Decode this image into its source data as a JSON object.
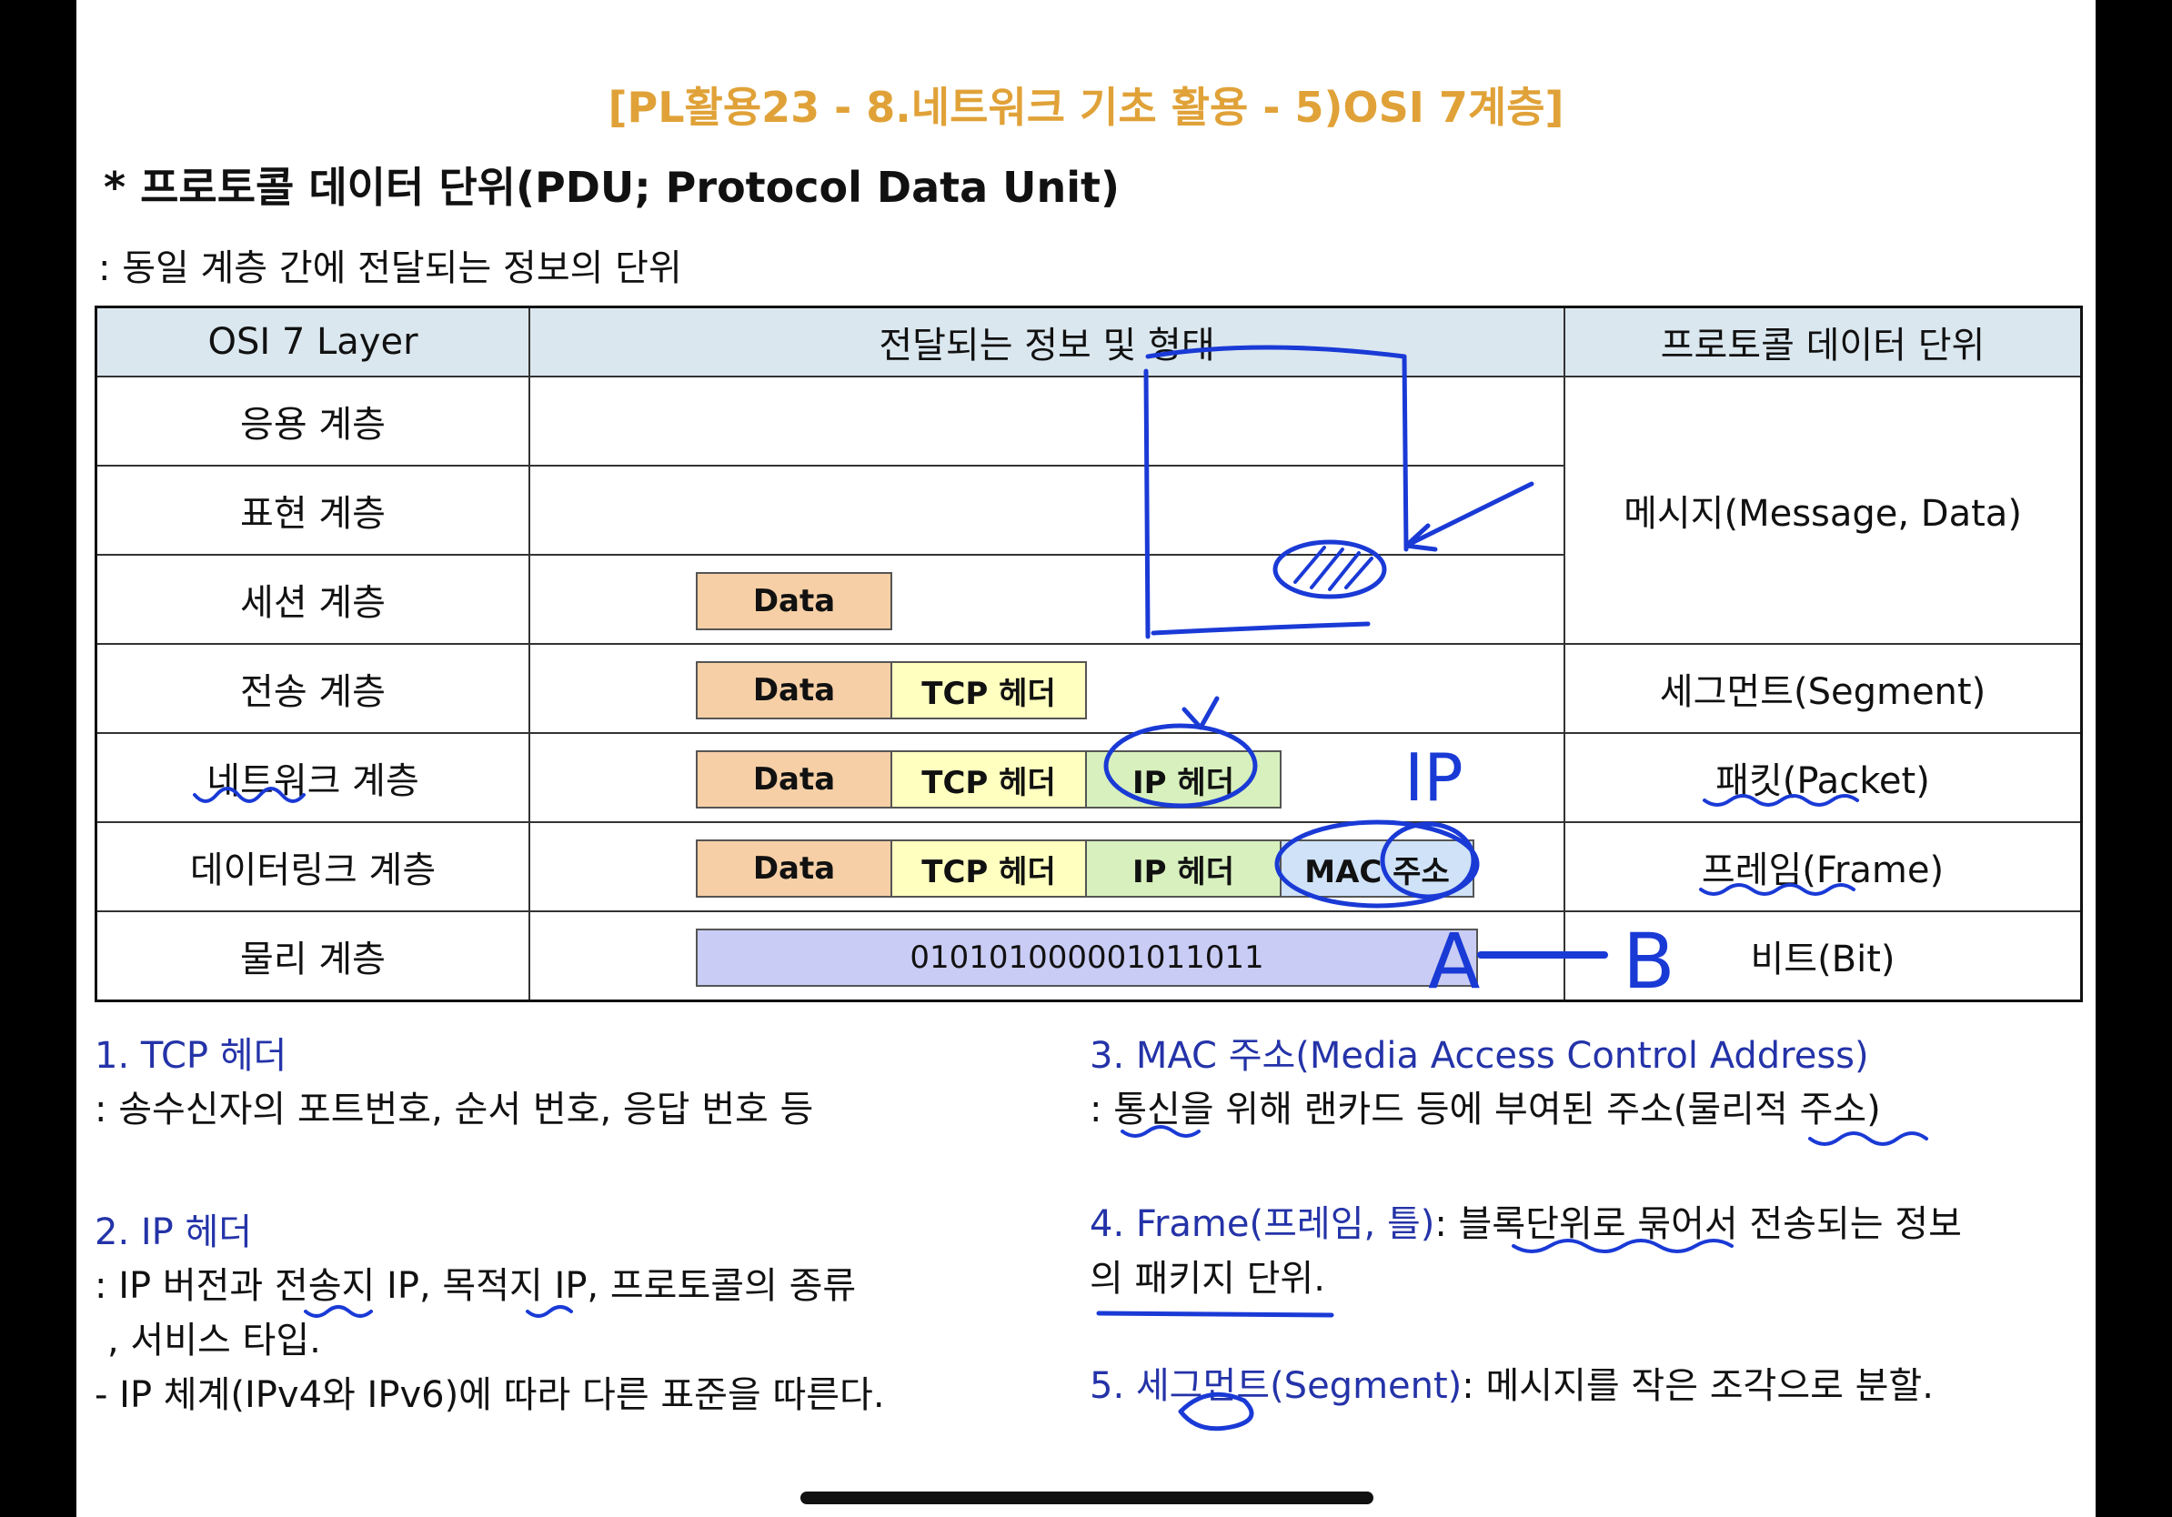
{
  "title": "[PL활용23 - 8.네트워크 기초 활용 - 5)OSI 7계층]",
  "heading": "* 프로토콜 데이터 단위(PDU; Protocol Data Unit)",
  "description": ": 동일 계층 간에 전달되는 정보의 단위",
  "table": {
    "headers": [
      "OSI 7 Layer",
      "전달되는 정보 및 형태",
      "프로토콜 데이터 단위"
    ],
    "layers": [
      "응용 계층",
      "표현 계층",
      "세션 계층",
      "전송 계층",
      "네트워크 계층",
      "데이터링크 계층",
      "물리 계층"
    ],
    "cells": {
      "data": "Data",
      "tcp_header": "TCP 헤더",
      "ip_header": "IP 헤더",
      "mac_address": "MAC 주소",
      "bits": "010101000001011011"
    },
    "pdu_units": [
      "메시지(Message, Data)",
      "세그먼트(Segment)",
      "패킷(Packet)",
      "프레임(Frame)",
      "비트(Bit)"
    ]
  },
  "notes_left": [
    {
      "title": "1. TCP 헤더",
      "lines": [
        ": 송수신자의 포트번호, 순서 번호, 응답 번호 등"
      ]
    },
    {
      "title": "2. IP 헤더",
      "lines": [
        ": IP 버전과 전송지 IP, 목적지 IP, 프로토콜의 종류",
        ", 서비스 타입.",
        "- IP 체계(IPv4와 IPv6)에 따라 다른 표준을 따른다."
      ]
    }
  ],
  "notes_right": [
    {
      "title": "3. MAC 주소(Media Access Control Address)",
      "lines": [
        ": 통신을 위해 랜카드 등에 부여된 주소(물리적 주소)"
      ]
    },
    {
      "title": "4. Frame(프레임, 틀)",
      "lines": [
        ": 블록단위로 묶어서 전송되는 정보",
        "의 패키지 단위."
      ]
    },
    {
      "title": "5. 세그먼트(Segment)",
      "lines": [
        ": 메시지를 작은 조각으로 분할."
      ]
    }
  ],
  "handwriting": {
    "ip": "IP",
    "a": "A",
    "b": "B"
  },
  "colors": {
    "title": "#e0a238",
    "header_bg": "#dbe7ef",
    "data": "#f6cfa6",
    "tcp": "#ffffbf",
    "ip": "#d7f0bd",
    "mac": "#cfe2f7",
    "bits": "#c9ccf4",
    "ink": "#1a3ad6",
    "note_title": "#2433a8"
  }
}
